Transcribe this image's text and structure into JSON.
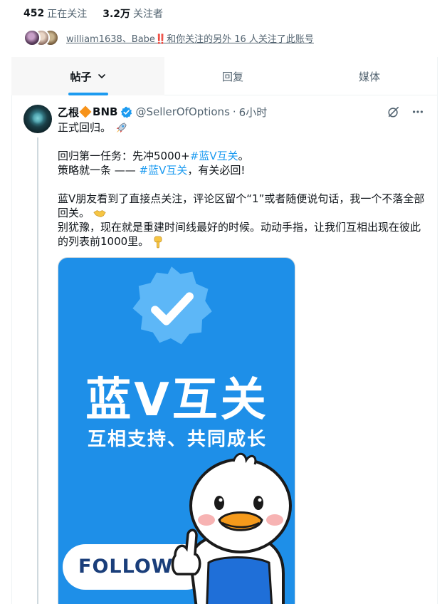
{
  "profile_stats": {
    "following_count": "452",
    "following_label": "正在关注",
    "followers_count": "3.2万",
    "followers_label": "关注者"
  },
  "followers_you_know": {
    "text": "william1638、Babe‼️和你关注的另外 16 人关注了此账号"
  },
  "tabs": [
    {
      "label": "帖子",
      "active": true
    },
    {
      "label": "回复",
      "active": false
    },
    {
      "label": "媒体",
      "active": false
    }
  ],
  "tweet": {
    "display_name_part1": "乙根",
    "display_name_part2": "BNB",
    "handle": "@SellerOfOptions",
    "separator": "·",
    "time": "6小时",
    "lines": {
      "l1": "正式回归。",
      "l2_prefix": "回归第一任务：先冲5000+",
      "l2_hashtag": "#蓝V互关",
      "l2_suffix": "。",
      "l3_prefix": "策略就一条 —— ",
      "l3_hashtag": "#蓝V互关",
      "l3_suffix": "，有关必回!",
      "l4": "蓝V朋友看到了直接点关注，评论区留个“1”或者随便说句话，我一个不落全部",
      "l5": "回关。",
      "l6": "别犹豫，现在就是重建时间线最好的时候。动动手指，让我们互相出现在彼此",
      "l7": "的列表前1000里。"
    },
    "media": {
      "title": "蓝V互关",
      "subtitle": "互相支持、共同成长",
      "button_text": "FOLLOW ME"
    }
  },
  "colors": {
    "accent": "#1d9bf0",
    "text_primary": "#0f1419",
    "text_secondary": "#536471",
    "media_bg": "#1e8fe8"
  }
}
